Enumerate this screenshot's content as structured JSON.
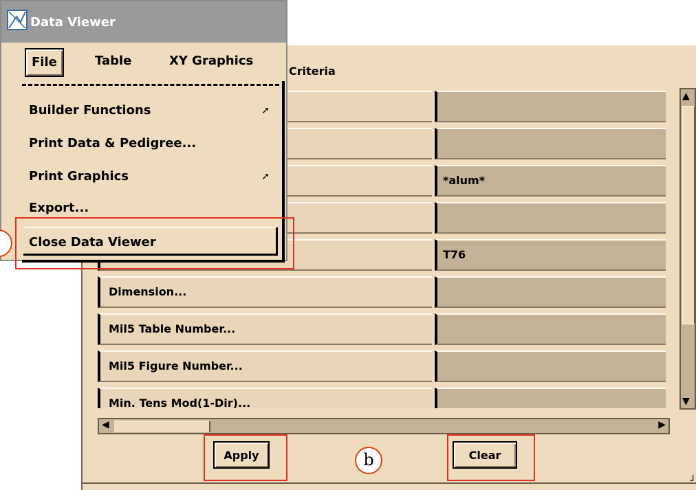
{
  "window": {
    "title": "Data Viewer"
  },
  "menubar": {
    "file": "File",
    "table": "Table",
    "xy_graphics": "XY Graphics"
  },
  "file_menu": {
    "items": [
      {
        "label": "Builder Functions",
        "submenu": true
      },
      {
        "label": "Print Data & Pedigree...",
        "submenu": false
      },
      {
        "label": "Print Graphics",
        "submenu": true
      },
      {
        "label": "Export...",
        "submenu": false
      },
      {
        "label": "Close Data Viewer",
        "submenu": false
      }
    ]
  },
  "criteria": {
    "header": "Criteria",
    "rows": [
      {
        "label": "",
        "value": ""
      },
      {
        "label": "",
        "value": ""
      },
      {
        "label": "",
        "value": "*alum*"
      },
      {
        "label": "",
        "value": ""
      },
      {
        "label": "",
        "value": "T76"
      },
      {
        "label": "Dimension...",
        "value": ""
      },
      {
        "label": "Mil5 Table Number...",
        "value": ""
      },
      {
        "label": "Mil5 Figure Number...",
        "value": ""
      },
      {
        "label": "Min. Tens Mod(1-Dir)...",
        "value": ""
      }
    ]
  },
  "buttons": {
    "apply": "Apply",
    "clear": "Clear"
  },
  "annotations": {
    "b": "b"
  },
  "colors": {
    "panel": "#efdcbe",
    "field": "#c4b296",
    "callout": "#e03020"
  }
}
